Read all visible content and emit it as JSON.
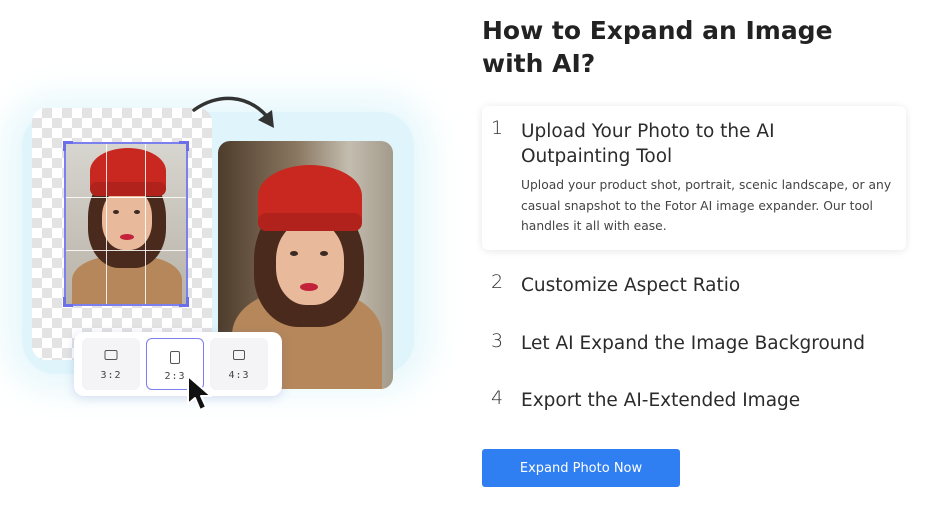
{
  "illustration": {
    "ratio_options": [
      {
        "label": "3:2",
        "selected": false
      },
      {
        "label": "2:3",
        "selected": true
      },
      {
        "label": "4:3",
        "selected": false
      }
    ],
    "accent_color": "#7b7ff0"
  },
  "section": {
    "heading": "How to Expand an Image with AI?",
    "steps": [
      {
        "number": "1",
        "title": "Upload Your Photo to the AI Outpainting Tool",
        "description": "Upload your product shot, portrait, scenic landscape, or any casual snapshot to the Fotor AI image expander. Our tool handles it all with ease.",
        "active": true
      },
      {
        "number": "2",
        "title": "Customize Aspect Ratio",
        "active": false
      },
      {
        "number": "3",
        "title": "Let AI Expand the Image Background",
        "active": false
      },
      {
        "number": "4",
        "title": "Export the AI-Extended Image",
        "active": false
      }
    ],
    "cta_label": "Expand Photo Now",
    "cta_color": "#2f7ff2"
  }
}
